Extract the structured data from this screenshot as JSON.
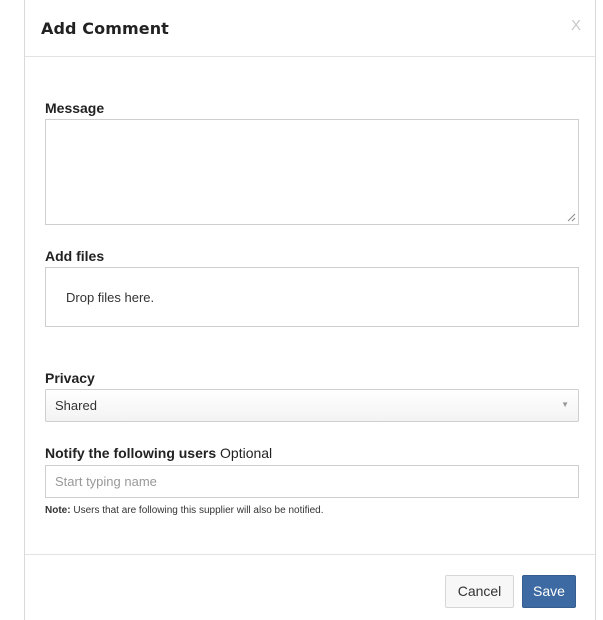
{
  "dialog": {
    "title": "Add Comment",
    "close_label": "X"
  },
  "message": {
    "label": "Message",
    "value": ""
  },
  "files": {
    "label": "Add files",
    "dropzone_text": "Drop files here."
  },
  "privacy": {
    "label": "Privacy",
    "selected": "Shared"
  },
  "notify": {
    "label": "Notify the following users",
    "optional": "Optional",
    "placeholder": "Start typing name",
    "value": "",
    "note_prefix": "Note:",
    "note_text": "Users that are following this supplier will also be notified."
  },
  "footer": {
    "cancel_label": "Cancel",
    "save_label": "Save"
  },
  "colors": {
    "primary": "#3d6aa2",
    "border": "#cfcfcf"
  },
  "icons": {
    "close": "close-icon",
    "caret": "chevron-down-icon",
    "resize": "resize-grip-icon"
  }
}
